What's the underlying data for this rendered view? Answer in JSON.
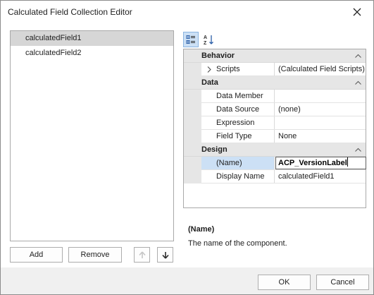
{
  "window": {
    "title": "Calculated Field Collection Editor"
  },
  "fields_list": {
    "items": [
      {
        "label": "calculatedField1",
        "selected": true
      },
      {
        "label": "calculatedField2",
        "selected": false
      }
    ]
  },
  "list_buttons": {
    "add": "Add",
    "remove": "Remove"
  },
  "property_grid": {
    "toolbar": {
      "categorized_active": true,
      "alphabetical_glyph": "A↓Z"
    },
    "categories": [
      {
        "name": "Behavior",
        "properties": [
          {
            "name": "Scripts",
            "value": "(Calculated Field Scripts)",
            "expandable": true
          }
        ]
      },
      {
        "name": "Data",
        "properties": [
          {
            "name": "Data Member",
            "value": ""
          },
          {
            "name": "Data Source",
            "value": "(none)"
          },
          {
            "name": "Expression",
            "value": ""
          },
          {
            "name": "Field Type",
            "value": "None"
          }
        ]
      },
      {
        "name": "Design",
        "properties": [
          {
            "name": "(Name)",
            "value": "ACP_VersionLabel",
            "selected": true,
            "editing": true
          },
          {
            "name": "Display Name",
            "value": "calculatedField1"
          }
        ]
      }
    ],
    "description": {
      "title": "(Name)",
      "text": "The name of the component."
    }
  },
  "footer": {
    "ok": "OK",
    "cancel": "Cancel"
  },
  "colors": {
    "selection_gray": "#d6d6d6",
    "selection_blue": "#cce0f5",
    "category_band": "#e6e6e6",
    "footer_bg": "#f0f0f0"
  }
}
